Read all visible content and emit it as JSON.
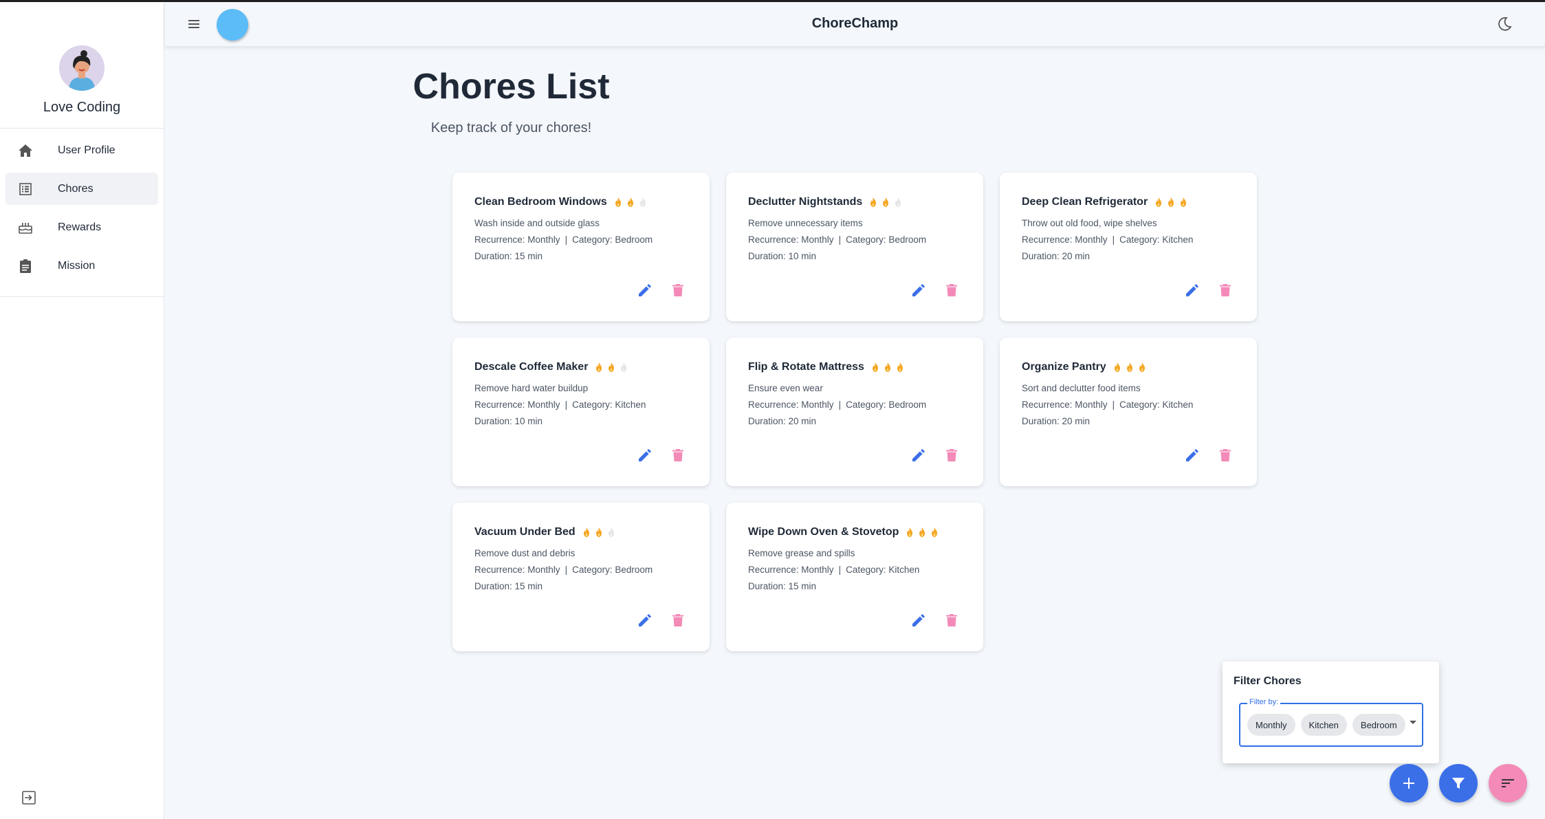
{
  "app": {
    "title": "ChoreChamp"
  },
  "sidebar": {
    "profile_name": "Love Coding",
    "items": [
      {
        "label": "User Profile",
        "icon": "home-icon"
      },
      {
        "label": "Chores",
        "icon": "list-icon",
        "active": true
      },
      {
        "label": "Rewards",
        "icon": "cake-icon"
      },
      {
        "label": "Mission",
        "icon": "clipboard-icon"
      }
    ]
  },
  "main": {
    "title": "Chores List",
    "subtitle": "Keep track of your chores!"
  },
  "chores": [
    {
      "name": "Clean Bedroom Windows",
      "difficulty": 2,
      "description": "Wash inside and outside glass",
      "recurrence": "Recurrence: Monthly",
      "category": "Category: Bedroom",
      "duration": "Duration: 15 min"
    },
    {
      "name": "Declutter Nightstands",
      "difficulty": 2,
      "description": "Remove unnecessary items",
      "recurrence": "Recurrence: Monthly",
      "category": "Category: Bedroom",
      "duration": "Duration: 10 min"
    },
    {
      "name": "Deep Clean Refrigerator",
      "difficulty": 3,
      "description": "Throw out old food, wipe shelves",
      "recurrence": "Recurrence: Monthly",
      "category": "Category: Kitchen",
      "duration": "Duration: 20 min"
    },
    {
      "name": "Descale Coffee Maker",
      "difficulty": 2,
      "description": "Remove hard water buildup",
      "recurrence": "Recurrence: Monthly",
      "category": "Category: Kitchen",
      "duration": "Duration: 10 min"
    },
    {
      "name": "Flip & Rotate Mattress",
      "difficulty": 3,
      "description": "Ensure even wear",
      "recurrence": "Recurrence: Monthly",
      "category": "Category: Bedroom",
      "duration": "Duration: 20 min"
    },
    {
      "name": "Organize Pantry",
      "difficulty": 3,
      "description": "Sort and declutter food items",
      "recurrence": "Recurrence: Monthly",
      "category": "Category: Kitchen",
      "duration": "Duration: 20 min"
    },
    {
      "name": "Vacuum Under Bed",
      "difficulty": 2,
      "description": "Remove dust and debris",
      "recurrence": "Recurrence: Monthly",
      "category": "Category: Bedroom",
      "duration": "Duration: 15 min"
    },
    {
      "name": "Wipe Down Oven & Stovetop",
      "difficulty": 3,
      "description": "Remove grease and spills",
      "recurrence": "Recurrence: Monthly",
      "category": "Category: Kitchen",
      "duration": "Duration: 15 min"
    }
  ],
  "card_separator": "|",
  "filter": {
    "title": "Filter Chores",
    "label": "Filter by:",
    "selected": [
      "Monthly",
      "Kitchen",
      "Bedroom"
    ]
  },
  "colors": {
    "accent": "#3b6fe8",
    "delete": "#f38ab8",
    "flame_active": "#f5a623",
    "flame_inactive": "#e5e5e5"
  }
}
